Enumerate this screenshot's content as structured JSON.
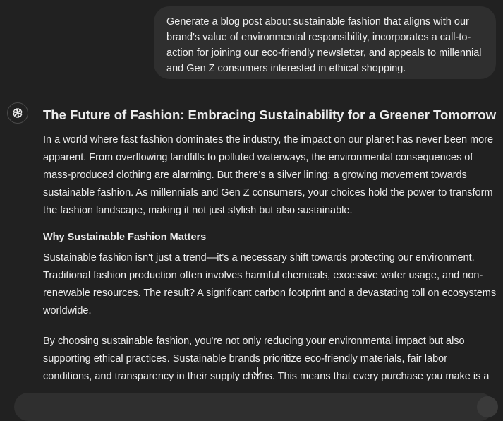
{
  "user_message": {
    "text": "Generate a blog post about sustainable fashion that aligns with our brand's value of environmental responsibility, incorporates a call-to-action for joining our eco-friendly newsletter, and appeals to millennial and Gen Z consumers interested in ethical shopping."
  },
  "assistant": {
    "avatar_icon": "openai-logo-icon",
    "title": "The Future of Fashion: Embracing Sustainability for a Greener Tomorrow",
    "intro": "In a world where fast fashion dominates the industry, the impact on our planet has never been more apparent. From overflowing landfills to polluted waterways, the environmental consequences of mass-produced clothing are alarming. But there's a silver lining: a growing movement towards sustainable fashion. As millennials and Gen Z consumers, your choices hold the power to transform the fashion landscape, making it not just stylish but also sustainable.",
    "section_heading": "Why Sustainable Fashion Matters",
    "section_paragraph_1": "Sustainable fashion isn't just a trend—it's a necessary shift towards protecting our environment. Traditional fashion production often involves harmful chemicals, excessive water usage, and non-renewable resources. The result? A significant carbon footprint and a devastating toll on ecosystems worldwide.",
    "section_paragraph_2": "By choosing sustainable fashion, you're not only reducing your environmental impact but also supporting ethical practices. Sustainable brands prioritize eco-friendly materials, fair labor conditions, and transparency in their supply chains. This means that every purchase you make is a"
  },
  "controls": {
    "scroll_down_icon": "arrow-down-icon"
  },
  "colors": {
    "background": "#212121",
    "bubble": "#2f2f2f",
    "text": "#ececec"
  }
}
